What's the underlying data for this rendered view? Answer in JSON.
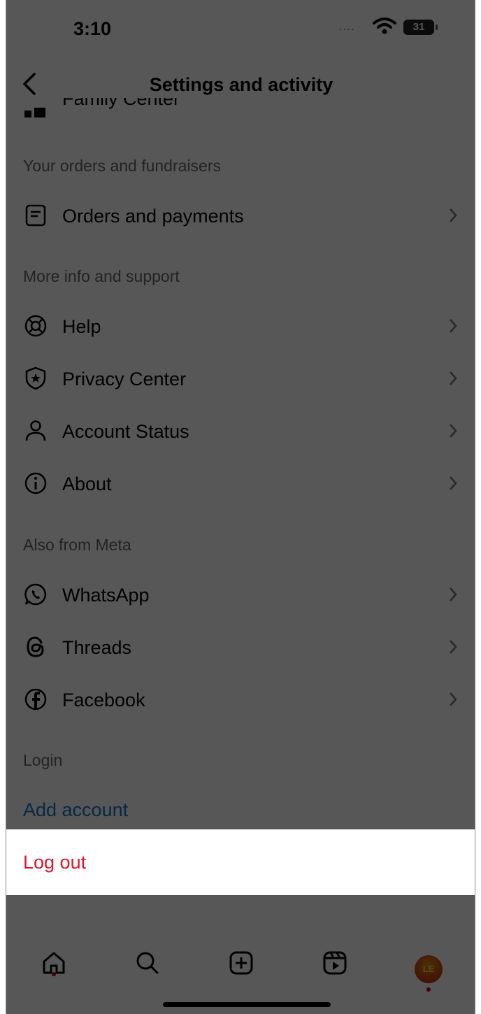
{
  "status_bar": {
    "time": "3:10",
    "battery": "31",
    "signal": "...."
  },
  "header": {
    "title": "Settings and activity"
  },
  "partial_row": {
    "label": "Family Center"
  },
  "sections": {
    "orders": {
      "title": "Your orders and fundraisers",
      "items": [
        {
          "label": "Orders and payments",
          "icon": "receipt-icon"
        }
      ]
    },
    "support": {
      "title": "More info and support",
      "items": [
        {
          "label": "Help",
          "icon": "lifebuoy-icon"
        },
        {
          "label": "Privacy Center",
          "icon": "shield-star-icon"
        },
        {
          "label": "Account Status",
          "icon": "person-icon"
        },
        {
          "label": "About",
          "icon": "info-icon"
        }
      ]
    },
    "meta": {
      "title": "Also from Meta",
      "items": [
        {
          "label": "WhatsApp",
          "icon": "whatsapp-icon"
        },
        {
          "label": "Threads",
          "icon": "threads-icon"
        },
        {
          "label": "Facebook",
          "icon": "facebook-icon"
        }
      ]
    },
    "login": {
      "title": "Login",
      "add_account": "Add account"
    }
  },
  "sheet": {
    "logout": "Log out"
  },
  "tabbar": {
    "tabs": [
      "home-icon",
      "search-icon",
      "create-icon",
      "reels-icon",
      "profile-avatar"
    ],
    "avatar_text": "LE"
  },
  "colors": {
    "link_blue": "#1a75c9",
    "logout_red": "#e0152b",
    "dim_overlay": "rgba(0,0,0,0.66)"
  }
}
